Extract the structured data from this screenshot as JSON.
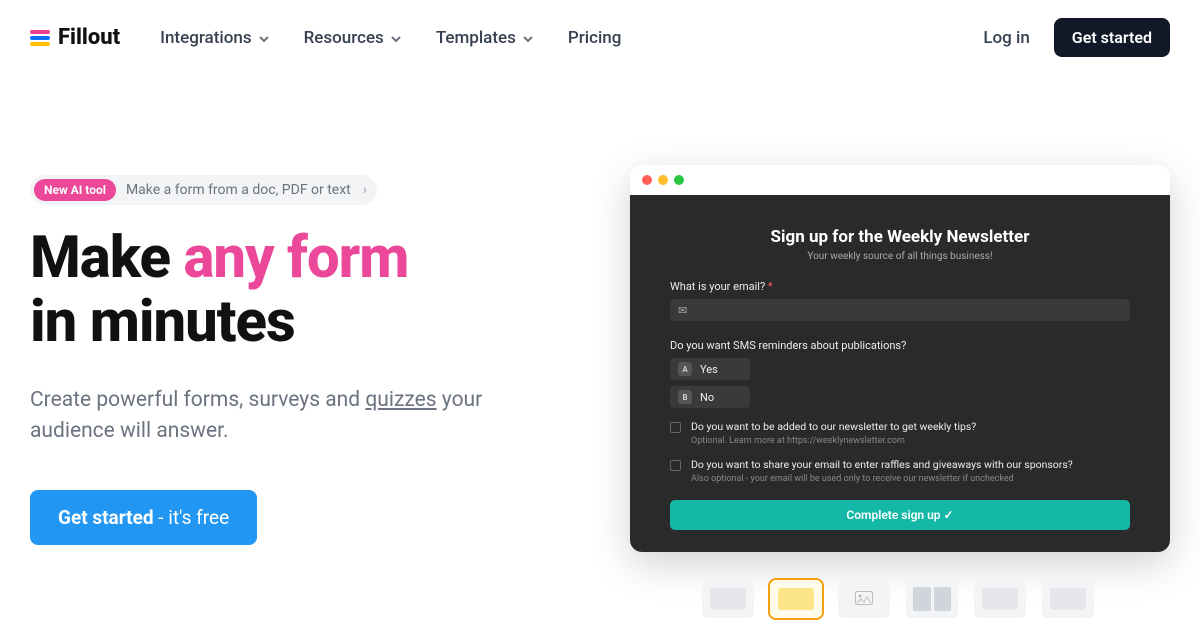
{
  "brand": "Fillout",
  "nav": {
    "integrations": "Integrations",
    "resources": "Resources",
    "templates": "Templates",
    "pricing": "Pricing"
  },
  "header": {
    "login": "Log in",
    "cta": "Get started"
  },
  "pill": {
    "badge": "New AI tool",
    "text": "Make a form from a doc, PDF or text"
  },
  "headline": {
    "pre": "Make ",
    "accent": "any form",
    "post": " in minutes"
  },
  "subhead": {
    "a": "Create powerful forms, surveys and ",
    "link": "quizzes",
    "b": " your audience will answer."
  },
  "cta_primary": {
    "bold": "Get started",
    "rest": " - it's free"
  },
  "preview": {
    "title": "Sign up for the Weekly Newsletter",
    "subtitle": "Your weekly source of all things business!",
    "q_email": "What is your email?",
    "q_sms": "Do you want SMS reminders about publications?",
    "opt_a_key": "A",
    "opt_a": "Yes",
    "opt_b_key": "B",
    "opt_b": "No",
    "check1": "Do you want to be added to our newsletter to get weekly tips?",
    "check1_sub": "Optional. Learn more at https://weeklynewsletter.com",
    "check2": "Do you want to share your email to enter raffles and giveaways with our sponsors?",
    "check2_sub": "Also optional - your email will be used only to receive our newsletter if unchecked",
    "submit": "Complete sign up ✓"
  }
}
